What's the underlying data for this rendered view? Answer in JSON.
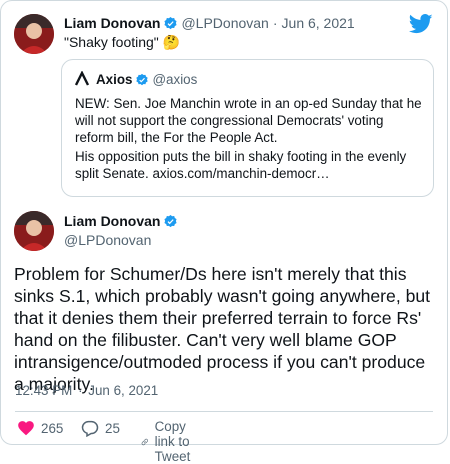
{
  "tweet1": {
    "author_name": "Liam Donovan",
    "author_handle": "@LPDonovan",
    "separator": "·",
    "date": "Jun 6, 2021",
    "text": "\"Shaky footing\"",
    "emoji": "🤔"
  },
  "quoted": {
    "author_name": "Axios",
    "author_handle": "@axios",
    "logo_glyph": "Λ",
    "paragraph1": "NEW: Sen. Joe Manchin wrote in an op-ed Sunday that he will not support the congressional Democrats' voting reform bill, the For the People Act.",
    "paragraph2": "His opposition puts the bill in shaky footing in the evenly split Senate.",
    "link": "axios.com/manchin-democr…"
  },
  "tweet2": {
    "author_name": "Liam Donovan",
    "author_handle": "@LPDonovan",
    "text": "Problem for Schumer/Ds here isn't merely that this sinks S.1, which probably wasn't going anywhere, but that it denies them their preferred terrain to force Rs' hand on the filibuster. Can't very well blame GOP intransigence/outmoded process if you can't produce a majority.",
    "time": "12:43 PM",
    "separator": "·",
    "date": "Jun 6, 2021",
    "likes": "265",
    "replies": "25",
    "copy_link_label": "Copy link to Tweet"
  },
  "colors": {
    "twitter_blue": "#1d9bf0",
    "like_red": "#f91880",
    "text_secondary": "#536471",
    "border": "#cfd9de"
  },
  "icons": [
    "twitter-logo-icon",
    "verified-badge-icon",
    "heart-icon",
    "reply-icon",
    "link-icon",
    "axios-logo-icon"
  ]
}
